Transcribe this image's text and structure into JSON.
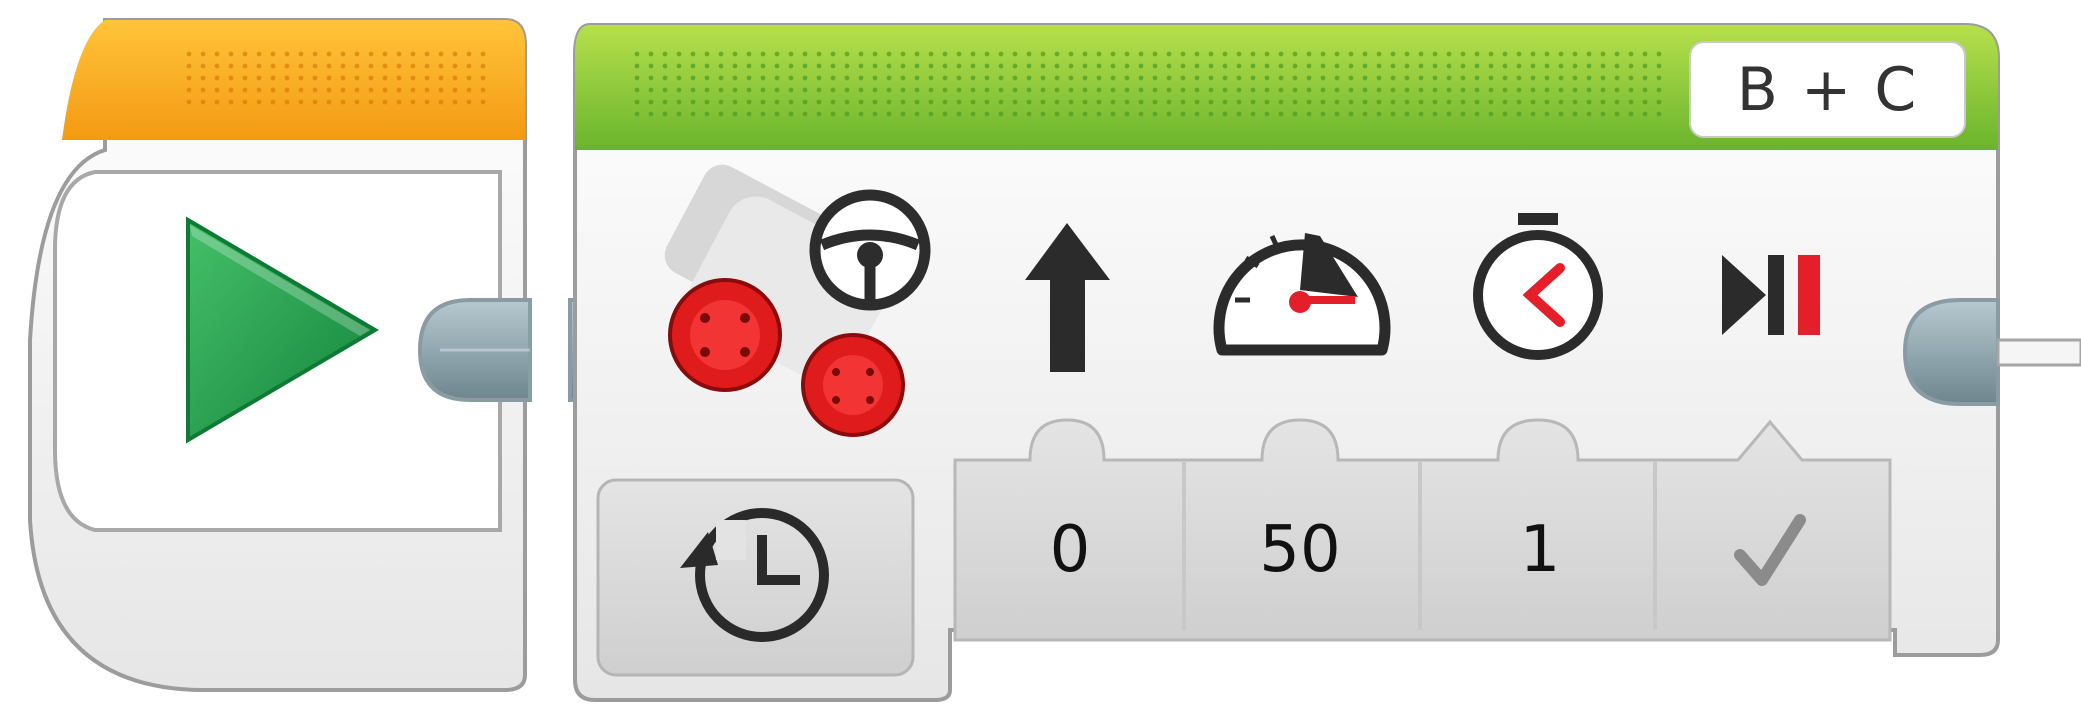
{
  "start_block": {
    "accent_color": "#f7a21b",
    "play_icon": "play-triangle-icon"
  },
  "move_tank_block": {
    "accent_color": "#7bc142",
    "ports_label": "B + C",
    "mode_icon": "timer-mode-icon",
    "parameters": [
      {
        "icon": "up-arrow-icon",
        "value": "0"
      },
      {
        "icon": "speedometer-icon",
        "value": "50"
      },
      {
        "icon": "stopwatch-icon",
        "value": "1"
      },
      {
        "icon": "brake-stop-icon",
        "value": "check-icon"
      }
    ]
  }
}
